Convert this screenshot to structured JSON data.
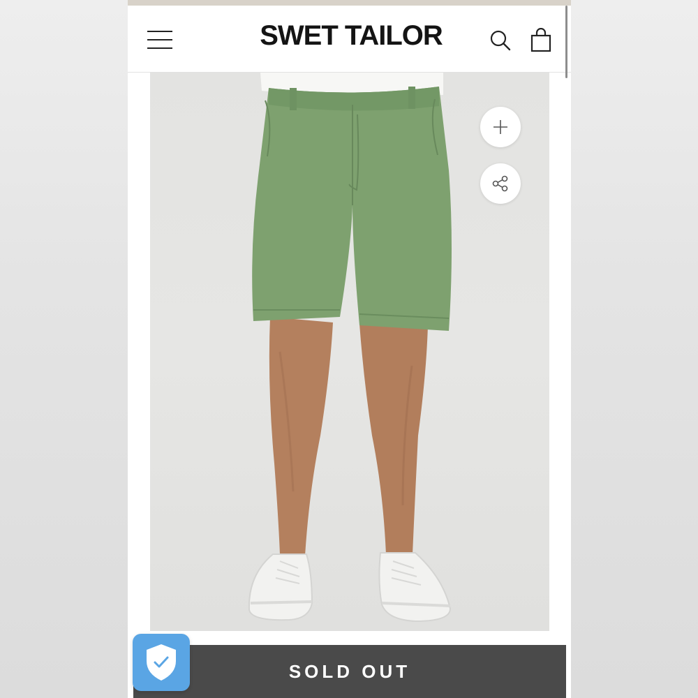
{
  "header": {
    "brand": "SWET TAILOR",
    "menu_icon": "hamburger-menu-icon",
    "search_icon": "search-icon",
    "cart_icon": "shopping-bag-icon"
  },
  "product": {
    "image": "green-chino-shorts-photo",
    "zoom_icon": "plus-icon",
    "share_icon": "share-icon"
  },
  "footer": {
    "sold_out_label": "SOLD OUT",
    "badge_icon": "shield-check-icon"
  },
  "colors": {
    "sold_out_bg": "#4a4a4a",
    "badge_bg": "#5aa5e4",
    "shorts": "#7ea16f",
    "brand_text": "#141414"
  }
}
